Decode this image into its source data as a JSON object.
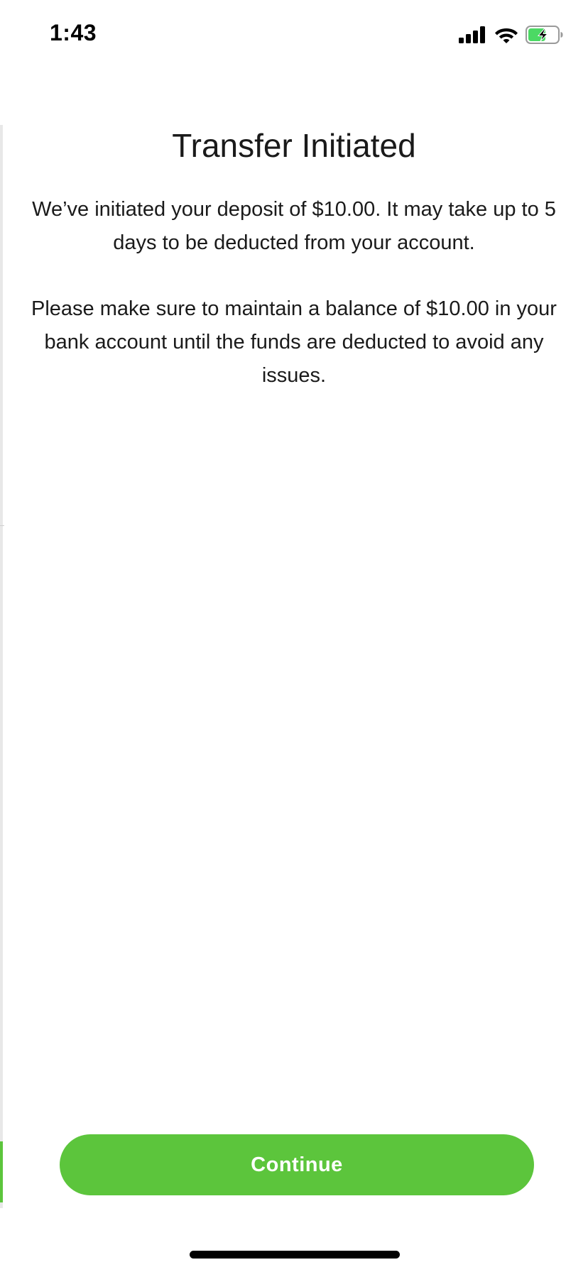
{
  "status_bar": {
    "time": "1:43",
    "icons": [
      "cellular-signal-icon",
      "wifi-icon",
      "battery-charging-icon"
    ],
    "battery_color": "#4cd964"
  },
  "screen": {
    "title": "Transfer Initiated",
    "message_1": "We’ve initiated your deposit of $10.00. It may take up to 5 days to be deducted from your account.",
    "message_2": "Please make sure to maintain a balance of $10.00 in your bank account until the funds are deducted to avoid any issues."
  },
  "actions": {
    "continue_label": "Continue"
  },
  "colors": {
    "accent": "#5cc53c",
    "text": "#1a1a1a",
    "background": "#ffffff"
  }
}
